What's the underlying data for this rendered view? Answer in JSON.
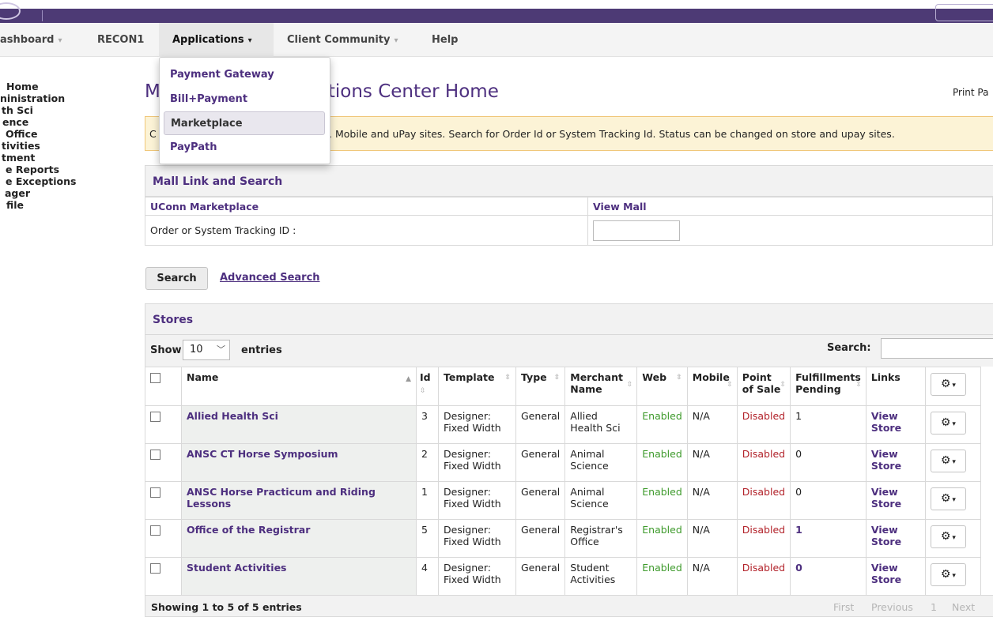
{
  "nav": {
    "items": [
      {
        "label": "ashboard",
        "caret": "▾"
      },
      {
        "label": "RECON1",
        "caret": ""
      },
      {
        "label": "Applications",
        "caret": "▾"
      },
      {
        "label": "Client Community",
        "caret": "▾"
      },
      {
        "label": "Help",
        "caret": ""
      }
    ]
  },
  "dropdown": {
    "items": [
      {
        "label": "Payment Gateway"
      },
      {
        "label": "Bill+Payment"
      },
      {
        "label": "Marketplace",
        "selected": true
      },
      {
        "label": "PayPath"
      }
    ]
  },
  "sidebar": {
    "items": [
      "Home",
      "ninistration",
      "th Sci",
      "ence",
      "Office",
      "tivities",
      "tment",
      "e Reports",
      "e Exceptions",
      "ager",
      "file"
    ]
  },
  "page": {
    "title_left": "M",
    "title_right": "tions Center Home",
    "print_label": "Print Pa",
    "notice_cap": "C",
    "notice_text": ", Mobile and uPay sites. Search for Order Id or System Tracking Id. Status can be changed on store and upay sites."
  },
  "mall": {
    "heading": "Mall Link and Search",
    "marketplace_link": "UConn Marketplace",
    "view_mall_link": "View Mall",
    "tracking_label": "Order or System Tracking ID :",
    "tracking_value": "",
    "search_button": "Search",
    "advanced_search": "Advanced Search"
  },
  "stores": {
    "heading": "Stores",
    "show_label": "Show",
    "page_length": "10",
    "entries_label": "entries",
    "search_label": "Search:",
    "search_value": "",
    "columns": [
      "Name",
      "Id",
      "Template",
      "Type",
      "Merchant Name",
      "Web",
      "Mobile",
      "Point of Sale",
      "Fulfillments Pending",
      "Links"
    ],
    "rows": [
      {
        "name": "Allied Health Sci",
        "id": "3",
        "template": "Designer: Fixed Width",
        "type": "General",
        "merchant": "Allied Health Sci",
        "web": "Enabled",
        "mobile": "N/A",
        "pos": "Disabled",
        "pending": "1",
        "pending_link": false,
        "link": "View Store"
      },
      {
        "name": "ANSC CT Horse Symposium",
        "id": "2",
        "template": "Designer: Fixed Width",
        "type": "General",
        "merchant": "Animal Science",
        "web": "Enabled",
        "mobile": "N/A",
        "pos": "Disabled",
        "pending": "0",
        "pending_link": false,
        "link": "View Store"
      },
      {
        "name": "ANSC Horse Practicum and Riding Lessons",
        "id": "1",
        "template": "Designer: Fixed Width",
        "type": "General",
        "merchant": "Animal Science",
        "web": "Enabled",
        "mobile": "N/A",
        "pos": "Disabled",
        "pending": "0",
        "pending_link": false,
        "link": "View Store"
      },
      {
        "name": "Office of the Registrar",
        "id": "5",
        "template": "Designer: Fixed Width",
        "type": "General",
        "merchant": "Registrar's Office",
        "web": "Enabled",
        "mobile": "N/A",
        "pos": "Disabled",
        "pending": "1",
        "pending_link": true,
        "link": "View Store"
      },
      {
        "name": "Student Activities",
        "id": "4",
        "template": "Designer: Fixed Width",
        "type": "General",
        "merchant": "Student Activities",
        "web": "Enabled",
        "mobile": "N/A",
        "pos": "Disabled",
        "pending": "0",
        "pending_link": true,
        "link": "View Store"
      }
    ],
    "showing_text": "Showing 1 to 5 of 5 entries",
    "pager": {
      "first": "First",
      "previous": "Previous",
      "page": "1",
      "next": "Next"
    }
  },
  "icons": {
    "gear": "gear-icon",
    "caret": "chevron-down-icon",
    "sort": "sort-icon"
  },
  "colors": {
    "brand_purple": "#4d2f7f",
    "topbar": "#4d3a75",
    "enabled": "#3d9a2b",
    "disabled": "#b2222a",
    "notice_bg": "#fcf3d6"
  }
}
